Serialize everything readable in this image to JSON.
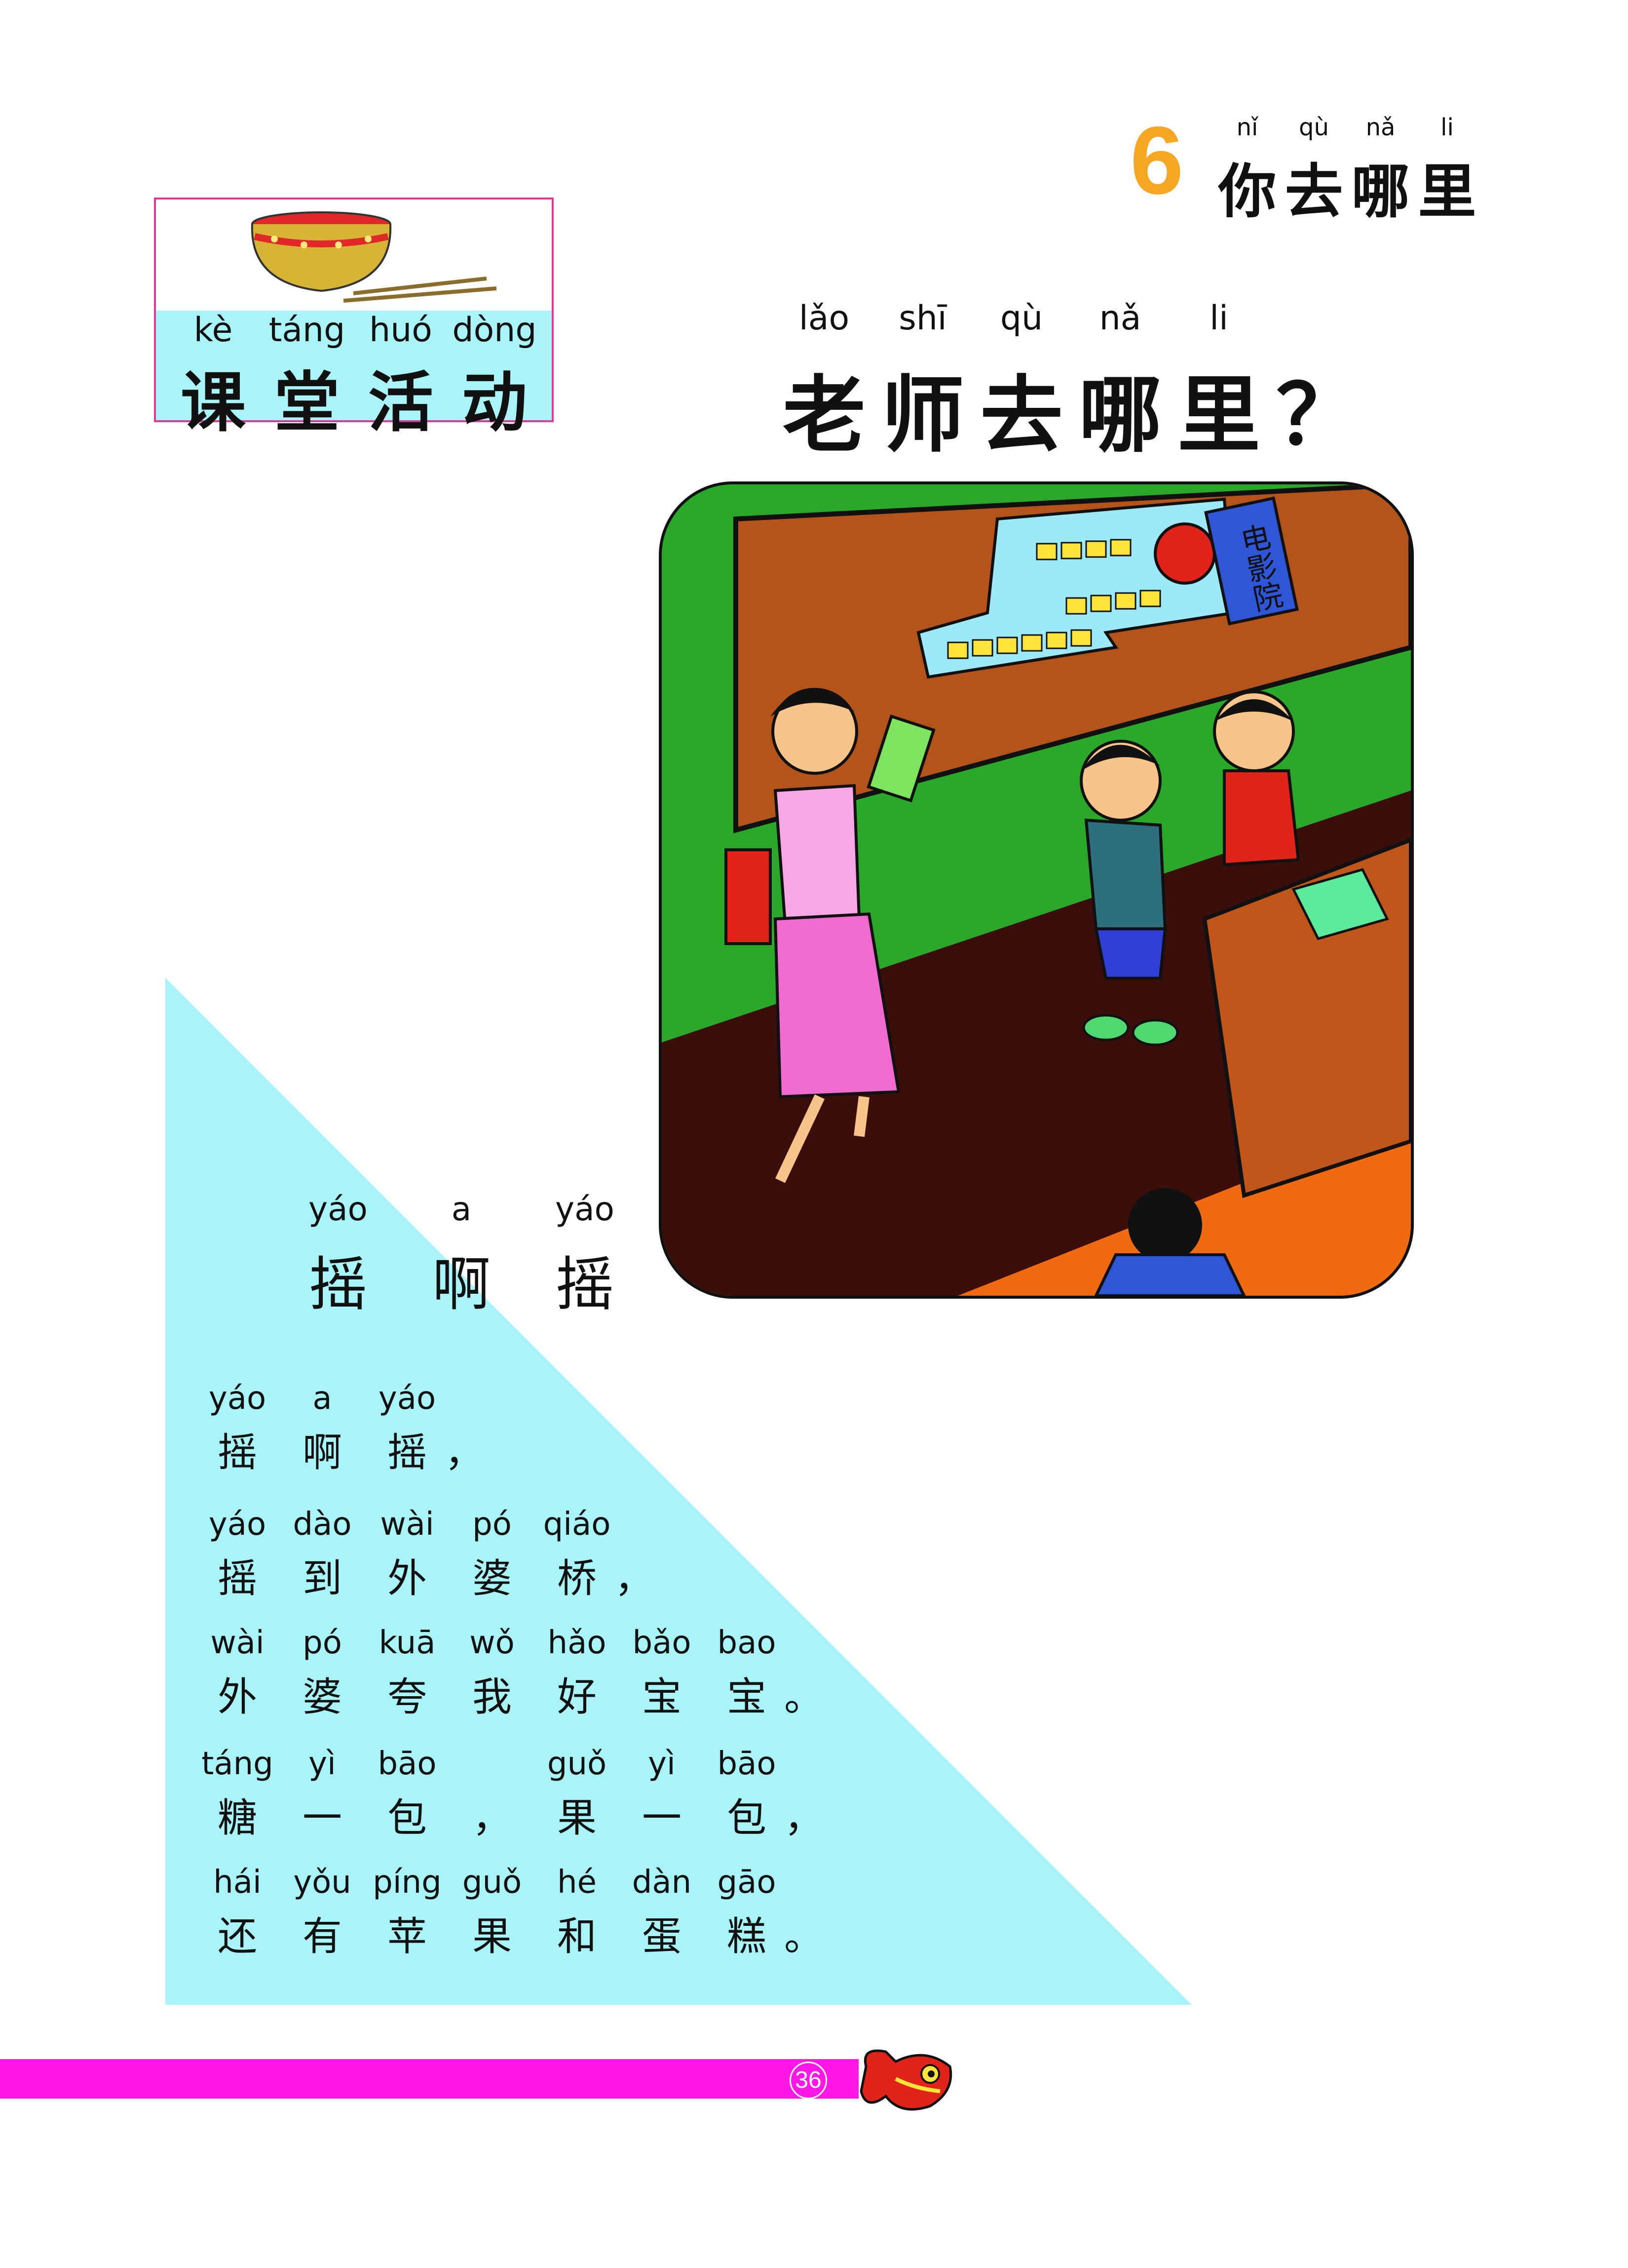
{
  "lesson": {
    "number": "6",
    "title": [
      {
        "pinyin": "nǐ",
        "hanzi": "你"
      },
      {
        "pinyin": "qù",
        "hanzi": "去"
      },
      {
        "pinyin": "nǎ",
        "hanzi": "哪"
      },
      {
        "pinyin": "li",
        "hanzi": "里"
      }
    ]
  },
  "activity": {
    "label": [
      {
        "pinyin": "kè",
        "hanzi": "课"
      },
      {
        "pinyin": "táng",
        "hanzi": "堂"
      },
      {
        "pinyin": "huó",
        "hanzi": "活"
      },
      {
        "pinyin": "dòng",
        "hanzi": "动"
      }
    ]
  },
  "question": [
    {
      "pinyin": "lǎo",
      "hanzi": "老"
    },
    {
      "pinyin": "shī",
      "hanzi": "师"
    },
    {
      "pinyin": "qù",
      "hanzi": "去"
    },
    {
      "pinyin": "nǎ",
      "hanzi": "哪"
    },
    {
      "pinyin": "li",
      "hanzi": "里"
    },
    {
      "pinyin": "",
      "hanzi": "？"
    }
  ],
  "picture": {
    "sign_text": "电影院"
  },
  "poem": {
    "title": [
      {
        "pinyin": "yáo",
        "hanzi": "摇"
      },
      {
        "pinyin": "a",
        "hanzi": "啊"
      },
      {
        "pinyin": "yáo",
        "hanzi": "摇"
      }
    ],
    "lines": [
      [
        {
          "pinyin": "yáo",
          "hanzi": "摇"
        },
        {
          "pinyin": "a",
          "hanzi": "啊"
        },
        {
          "pinyin": "yáo",
          "hanzi": "摇"
        },
        {
          "pinyin": "",
          "hanzi": "，"
        }
      ],
      [
        {
          "pinyin": "yáo",
          "hanzi": "摇"
        },
        {
          "pinyin": "dào",
          "hanzi": "到"
        },
        {
          "pinyin": "wài",
          "hanzi": "外"
        },
        {
          "pinyin": "pó",
          "hanzi": "婆"
        },
        {
          "pinyin": "qiáo",
          "hanzi": "桥"
        },
        {
          "pinyin": "",
          "hanzi": "，"
        }
      ],
      [
        {
          "pinyin": "wài",
          "hanzi": "外"
        },
        {
          "pinyin": "pó",
          "hanzi": "婆"
        },
        {
          "pinyin": "kuā",
          "hanzi": "夸"
        },
        {
          "pinyin": "wǒ",
          "hanzi": "我"
        },
        {
          "pinyin": "hǎo",
          "hanzi": "好"
        },
        {
          "pinyin": "bǎo",
          "hanzi": "宝"
        },
        {
          "pinyin": "bao",
          "hanzi": "宝"
        },
        {
          "pinyin": "",
          "hanzi": "。"
        }
      ],
      [
        {
          "pinyin": "táng",
          "hanzi": "糖"
        },
        {
          "pinyin": "yì",
          "hanzi": "一"
        },
        {
          "pinyin": "bāo",
          "hanzi": "包"
        },
        {
          "pinyin": "",
          "hanzi": "，"
        },
        {
          "pinyin": "guǒ",
          "hanzi": "果"
        },
        {
          "pinyin": "yì",
          "hanzi": "一"
        },
        {
          "pinyin": "bāo",
          "hanzi": "包"
        },
        {
          "pinyin": "",
          "hanzi": "，"
        }
      ],
      [
        {
          "pinyin": "hái",
          "hanzi": "还"
        },
        {
          "pinyin": "yǒu",
          "hanzi": "有"
        },
        {
          "pinyin": "píng",
          "hanzi": "苹"
        },
        {
          "pinyin": "guǒ",
          "hanzi": "果"
        },
        {
          "pinyin": "hé",
          "hanzi": "和"
        },
        {
          "pinyin": "dàn",
          "hanzi": "蛋"
        },
        {
          "pinyin": "gāo",
          "hanzi": "糕"
        },
        {
          "pinyin": "",
          "hanzi": "。"
        }
      ]
    ]
  },
  "footer": {
    "page_number": "36"
  },
  "colors": {
    "lesson_number": "#f5a623",
    "activity_border": "#e0399c",
    "activity_band": "#a8f4f8",
    "triangle": "#a8f4f8",
    "footer_bar": "#ff17e5"
  }
}
